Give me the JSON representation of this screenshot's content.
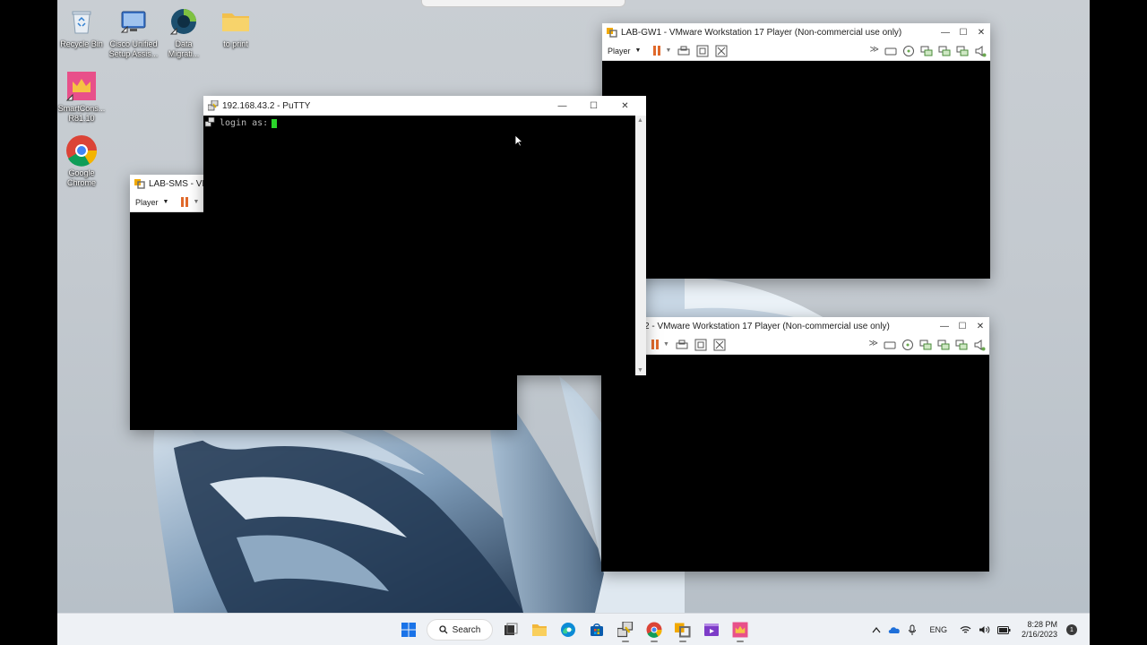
{
  "desktop_icons": [
    {
      "label": "Recycle Bin",
      "icon": "recycle-bin-icon"
    },
    {
      "label": "Cisco Unified\nSetup Assis...",
      "icon": "cisco-setup-icon"
    },
    {
      "label": "Data\nMigrati...",
      "icon": "data-migration-icon"
    },
    {
      "label": "to print",
      "icon": "folder-icon"
    },
    {
      "label": "SmartCons...\nR81.10",
      "icon": "smartconsole-icon"
    },
    {
      "label": "Google\nChrome",
      "icon": "chrome-icon"
    }
  ],
  "windows": {
    "lab_sms": {
      "title": "LAB-SMS - VMw",
      "player_label": "Player"
    },
    "putty": {
      "title": "192.168.43.2 - PuTTY",
      "terminal_text": "login as:"
    },
    "lab_gw1": {
      "title": "LAB-GW1 - VMware Workstation 17 Player (Non-commercial use only)",
      "player_label": "Player"
    },
    "lab_gw2": {
      "title": "2 - VMware Workstation 17 Player (Non-commercial use only)"
    }
  },
  "taskbar": {
    "search_label": "Search",
    "apps": [
      "start-icon",
      "search-icon",
      "task-view-icon",
      "file-explorer-icon",
      "edge-icon",
      "store-icon",
      "putty-icon",
      "chrome-icon",
      "vmware-player-icon",
      "media-icon",
      "smartconsole-icon"
    ],
    "tray": {
      "language": "ENG",
      "time": "8:28 PM",
      "date": "2/16/2023",
      "notification_count": "1"
    }
  },
  "colors": {
    "vmware_pause": "#e0692b",
    "terminal_cursor": "#2ad62a",
    "taskbar_bg": "#eef1f5"
  }
}
